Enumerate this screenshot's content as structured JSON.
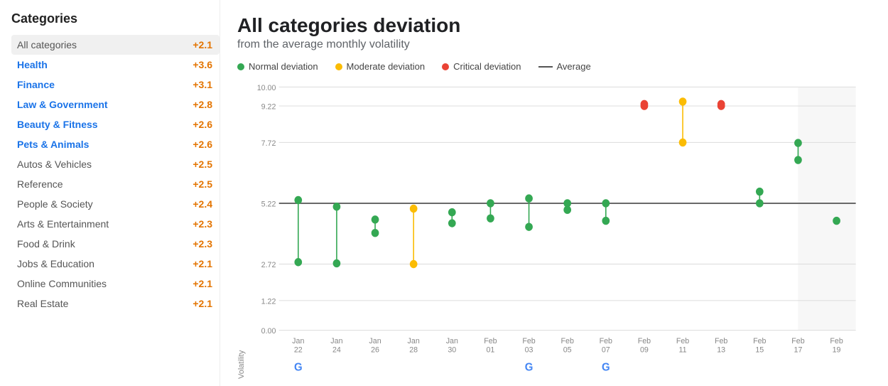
{
  "sidebar": {
    "title": "Categories",
    "items": [
      {
        "label": "All categories",
        "value": "+2.1",
        "blue": false,
        "selected": true,
        "valueColor": "orange"
      },
      {
        "label": "Health",
        "value": "+3.6",
        "blue": true,
        "selected": false,
        "valueColor": "orange"
      },
      {
        "label": "Finance",
        "value": "+3.1",
        "blue": true,
        "selected": false,
        "valueColor": "orange"
      },
      {
        "label": "Law & Government",
        "value": "+2.8",
        "blue": true,
        "selected": false,
        "valueColor": "orange"
      },
      {
        "label": "Beauty & Fitness",
        "value": "+2.6",
        "blue": true,
        "selected": false,
        "valueColor": "orange"
      },
      {
        "label": "Pets & Animals",
        "value": "+2.6",
        "blue": true,
        "selected": false,
        "valueColor": "orange"
      },
      {
        "label": "Autos & Vehicles",
        "value": "+2.5",
        "blue": false,
        "selected": false,
        "valueColor": "orange"
      },
      {
        "label": "Reference",
        "value": "+2.5",
        "blue": false,
        "selected": false,
        "valueColor": "orange"
      },
      {
        "label": "People & Society",
        "value": "+2.4",
        "blue": false,
        "selected": false,
        "valueColor": "orange"
      },
      {
        "label": "Arts & Entertainment",
        "value": "+2.3",
        "blue": false,
        "selected": false,
        "valueColor": "orange"
      },
      {
        "label": "Food & Drink",
        "value": "+2.3",
        "blue": false,
        "selected": false,
        "valueColor": "orange"
      },
      {
        "label": "Jobs & Education",
        "value": "+2.1",
        "blue": false,
        "selected": false,
        "valueColor": "orange"
      },
      {
        "label": "Online Communities",
        "value": "+2.1",
        "blue": false,
        "selected": false,
        "valueColor": "orange"
      },
      {
        "label": "Real Estate",
        "value": "+2.1",
        "blue": false,
        "selected": false,
        "valueColor": "orange"
      }
    ]
  },
  "chart": {
    "title": "All categories deviation",
    "subtitle": "from the average monthly volatility",
    "yAxisLabel": "Volatility",
    "legend": {
      "normal": "Normal deviation",
      "moderate": "Moderate deviation",
      "critical": "Critical deviation",
      "average": "Average"
    },
    "yTicks": [
      "10.00",
      "9.22",
      "7.72",
      "5.22",
      "2.72",
      "1.22",
      "0.00"
    ],
    "xLabels": [
      {
        "label": "Jan\n22",
        "hasG": true
      },
      {
        "label": "Jan\n24",
        "hasG": false
      },
      {
        "label": "Jan\n26",
        "hasG": false
      },
      {
        "label": "Jan\n28",
        "hasG": false
      },
      {
        "label": "Jan\n30",
        "hasG": false
      },
      {
        "label": "Feb\n01",
        "hasG": false
      },
      {
        "label": "Feb\n03",
        "hasG": true
      },
      {
        "label": "Feb\n05",
        "hasG": false
      },
      {
        "label": "Feb\n07",
        "hasG": true
      },
      {
        "label": "Feb\n09",
        "hasG": false
      },
      {
        "label": "Feb\n11",
        "hasG": false
      },
      {
        "label": "Feb\n13",
        "hasG": false
      },
      {
        "label": "Feb\n15",
        "hasG": false
      },
      {
        "label": "Feb\n17",
        "hasG": false
      },
      {
        "label": "Feb\n19",
        "hasG": false
      }
    ]
  }
}
